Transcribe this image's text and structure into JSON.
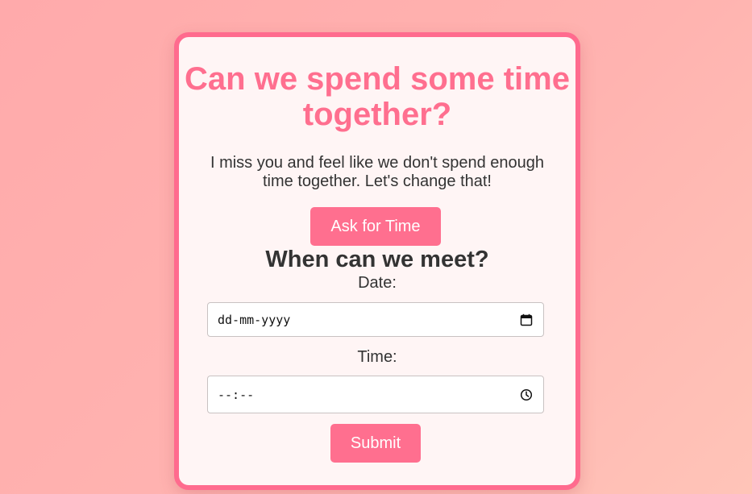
{
  "card": {
    "title": "Can we spend some time together?",
    "message": "I miss you and feel like we don't spend enough time together. Let's change that!",
    "ask_button": "Ask for Time"
  },
  "meeting": {
    "heading": "When can we meet?",
    "date_label": "Date:",
    "date_value": "dd-mm-yyyy",
    "date_icon": "calendar-icon",
    "time_label": "Time:",
    "time_value": "--:--",
    "time_icon": "clock-icon",
    "submit_button": "Submit"
  },
  "colors": {
    "accent": "#ff6f8f",
    "card_border": "#ff6b8e",
    "card_background": "#fff5f5",
    "text": "#333333"
  }
}
